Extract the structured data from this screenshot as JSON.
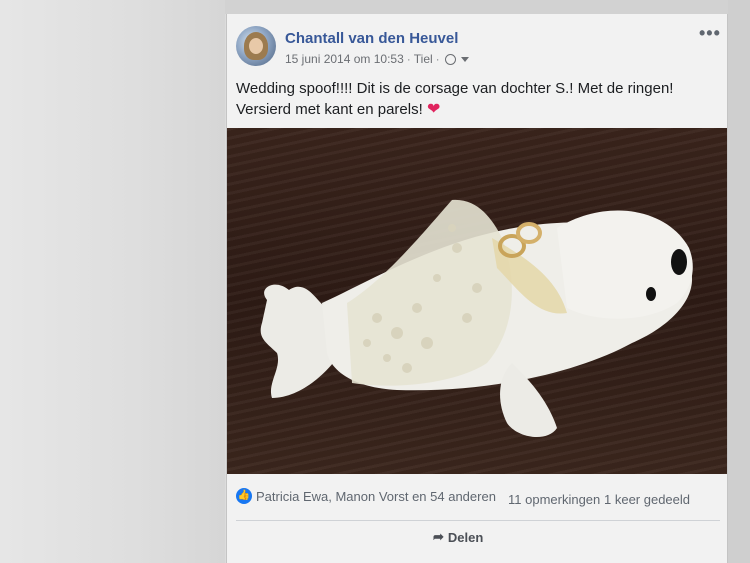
{
  "post": {
    "author": "Chantall van den Heuvel",
    "date": "15 juni 2014 om 10:53",
    "location": "Tiel",
    "separator": "·",
    "icons": {
      "privacy": "globe-icon",
      "privacy_menu": "caret-down-icon",
      "more": "more-options-icon",
      "heart": "heart-icon",
      "like": "like-icon",
      "share": "share-arrow-icon"
    },
    "more_label": "•••",
    "text_line1": "Wedding spoof!!!! Dit is de corsage van dochter S.! Met de ringen!",
    "text_line2": "Versierd met kant en parels!",
    "heart_glyph": "❤",
    "image": "photo-stuffed-seal-with-lace-and-rings"
  },
  "reactions": {
    "like_glyph": "👍",
    "names": "Patricia Ewa, Manon Vorst en 54 anderen",
    "comments": "11 opmerkingen",
    "shares": "1 keer gedeeld"
  },
  "actions": {
    "share_glyph": "➦",
    "share_label": "Delen"
  },
  "colors": {
    "author_link": "#385898",
    "heart": "#e0245e",
    "like_badge": "#1877f2"
  }
}
